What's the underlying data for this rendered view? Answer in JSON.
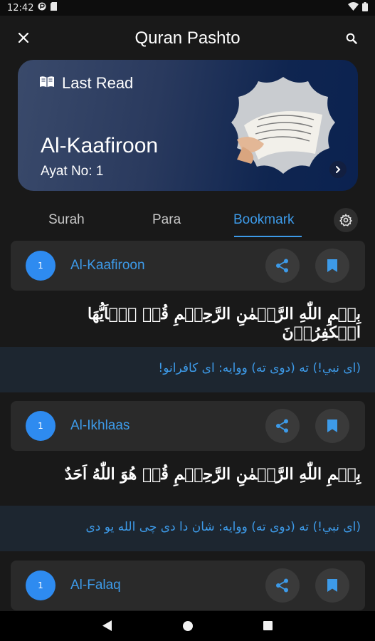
{
  "status_bar": {
    "time": "12:42"
  },
  "app_bar": {
    "title": "Quran Pashto"
  },
  "last_read": {
    "heading": "Last Read",
    "surah": "Al-Kaafiroon",
    "ayat": "Ayat No: 1"
  },
  "tabs": [
    {
      "label": "Surah",
      "active": false
    },
    {
      "label": "Para",
      "active": false
    },
    {
      "label": "Bookmark",
      "active": true
    }
  ],
  "bookmarks": [
    {
      "number": "1",
      "name": "Al-Kaafiroon",
      "arabic": "بِسۡمِ اللّٰهِ الرَّحۡمٰنِ الرَّحِيۡمِ قُلۡ يٰۤاَيُّهَا الۡكٰفِرُوۡنَ",
      "translation": "(ای نبي!) ته (دوی ته) ووایه: ای کافرانو!"
    },
    {
      "number": "1",
      "name": "Al-Ikhlaas",
      "arabic": "بِسۡمِ اللّٰهِ الرَّحۡمٰنِ الرَّحِيۡمِ قُلۡ هُوَ اللّٰهُ اَحَدٌ",
      "translation": "(ای نبي!) ته (دوی ته) ووایه: شان دا دی چی الله یو دی"
    },
    {
      "number": "1",
      "name": "Al-Falaq"
    }
  ],
  "colors": {
    "accent": "#3d9ae8",
    "number_badge": "#2e8bf0",
    "card": "#2a2a2a",
    "background": "#191919"
  }
}
